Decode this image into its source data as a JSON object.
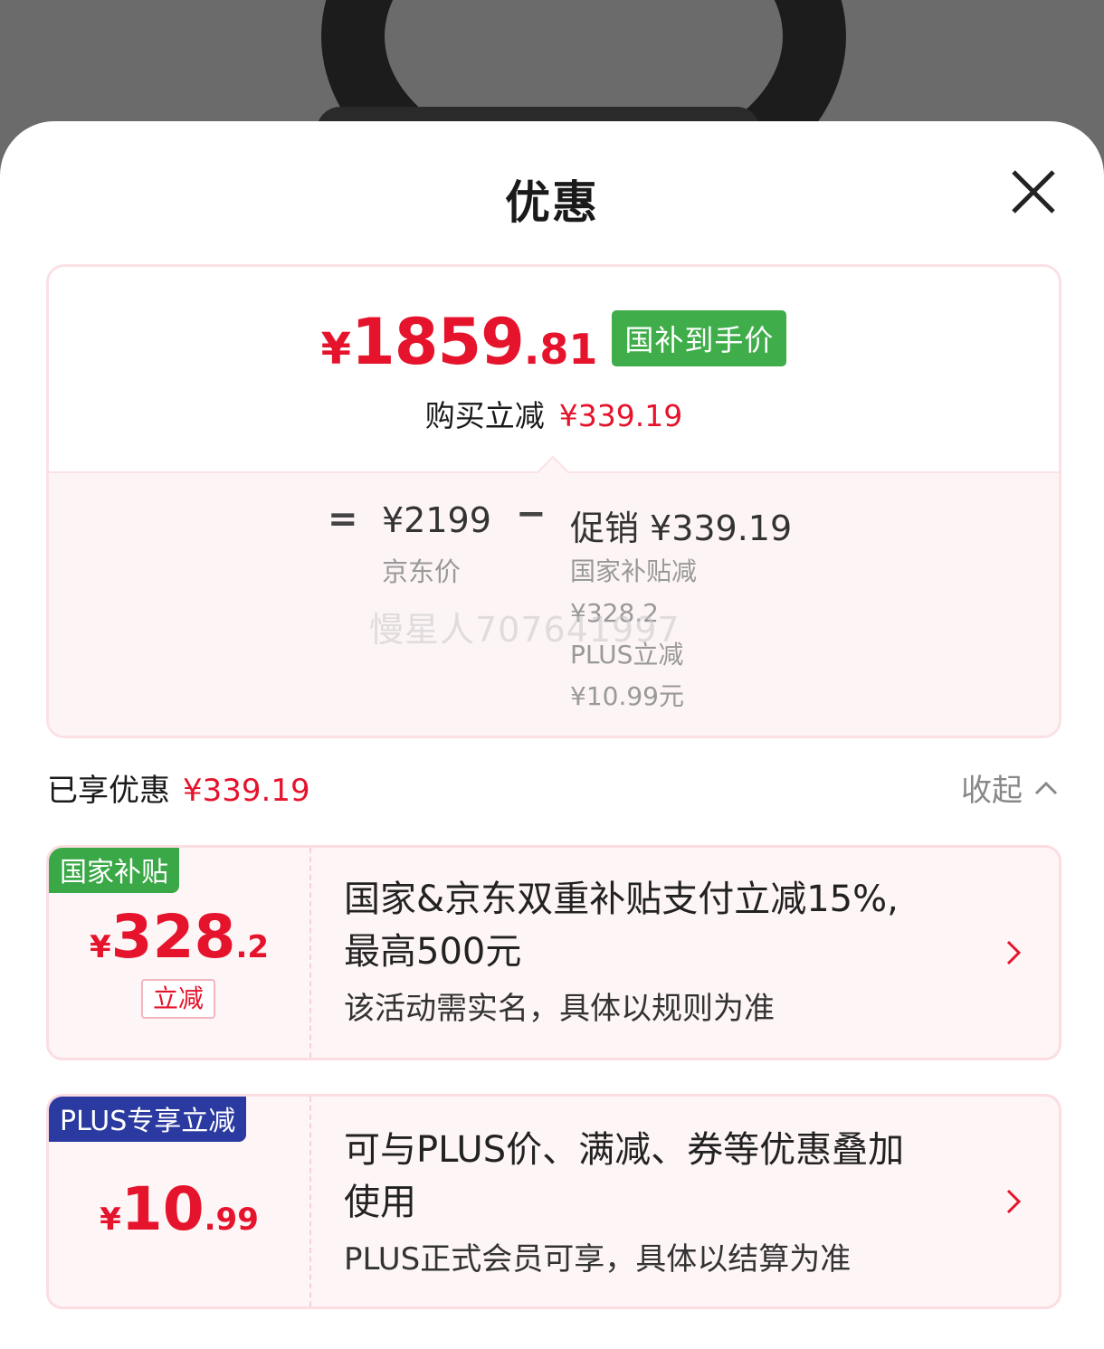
{
  "sheet": {
    "title": "优惠"
  },
  "price_card": {
    "final_price": {
      "currency": "¥",
      "integer": "1859",
      "decimal": ".81"
    },
    "subsidy_tag": "国补到手价",
    "saving_label": "购买立减",
    "saving_amount": "¥339.19",
    "breakdown": {
      "equals": "=",
      "jd_price": "¥2199",
      "jd_label": "京东价",
      "minus": "−",
      "promo_label": "促销",
      "promo_amount": "¥339.19",
      "promo_details": [
        "国家补贴减",
        "¥328.2",
        "PLUS立减",
        "¥10.99元"
      ]
    },
    "watermark": "慢星人707641997"
  },
  "enjoyed": {
    "label": "已享优惠",
    "amount": "¥339.19",
    "collapse_label": "收起"
  },
  "coupons": [
    {
      "tag": "国家补贴",
      "amount": {
        "currency": "¥",
        "integer": "328",
        "decimal": ".2"
      },
      "badge": "立减",
      "title_line1": "国家&京东双重补贴支付立减15%,",
      "title_line2": "最高500元",
      "desc": "该活动需实名，具体以规则为准"
    },
    {
      "tag": "PLUS专享立减",
      "amount": {
        "currency": "¥",
        "integer": "10",
        "decimal": ".99"
      },
      "title_line1": "可与PLUS价、满减、券等优惠叠加",
      "title_line2": "使用",
      "desc": "PLUS正式会员可享，具体以结算为准"
    }
  ],
  "colors": {
    "accent_red": "#e5132b",
    "subsidy_green": "#3fad4a",
    "plus_blue": "#2b3aa0"
  }
}
